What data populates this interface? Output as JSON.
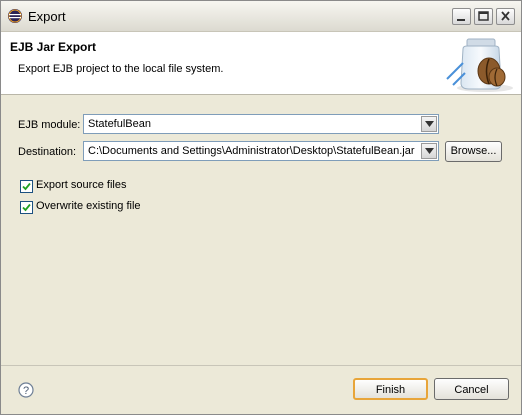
{
  "window": {
    "title": "Export"
  },
  "banner": {
    "title": "EJB Jar Export",
    "description": "Export EJB project to the local file system."
  },
  "form": {
    "module_label": "EJB module:",
    "module_value": "StatefulBean",
    "destination_label": "Destination:",
    "destination_value": "C:\\Documents and Settings\\Administrator\\Desktop\\StatefulBean.jar",
    "browse_label": "Browse...",
    "export_source_label": "Export source files",
    "export_source_checked": true,
    "overwrite_label": "Overwrite existing file",
    "overwrite_checked": true
  },
  "footer": {
    "finish_label": "Finish",
    "cancel_label": "Cancel"
  },
  "icons": {
    "app": "eclipse-icon",
    "minimize": "minimize-icon",
    "maximize": "maximize-icon",
    "close": "close-icon",
    "banner": "jar-wizard-icon",
    "help": "help-icon",
    "dropdown": "chevron-down-icon",
    "check": "checkmark-icon"
  },
  "colors": {
    "accent_focus": "#e8a53a",
    "checkbox_check": "#21a121"
  }
}
